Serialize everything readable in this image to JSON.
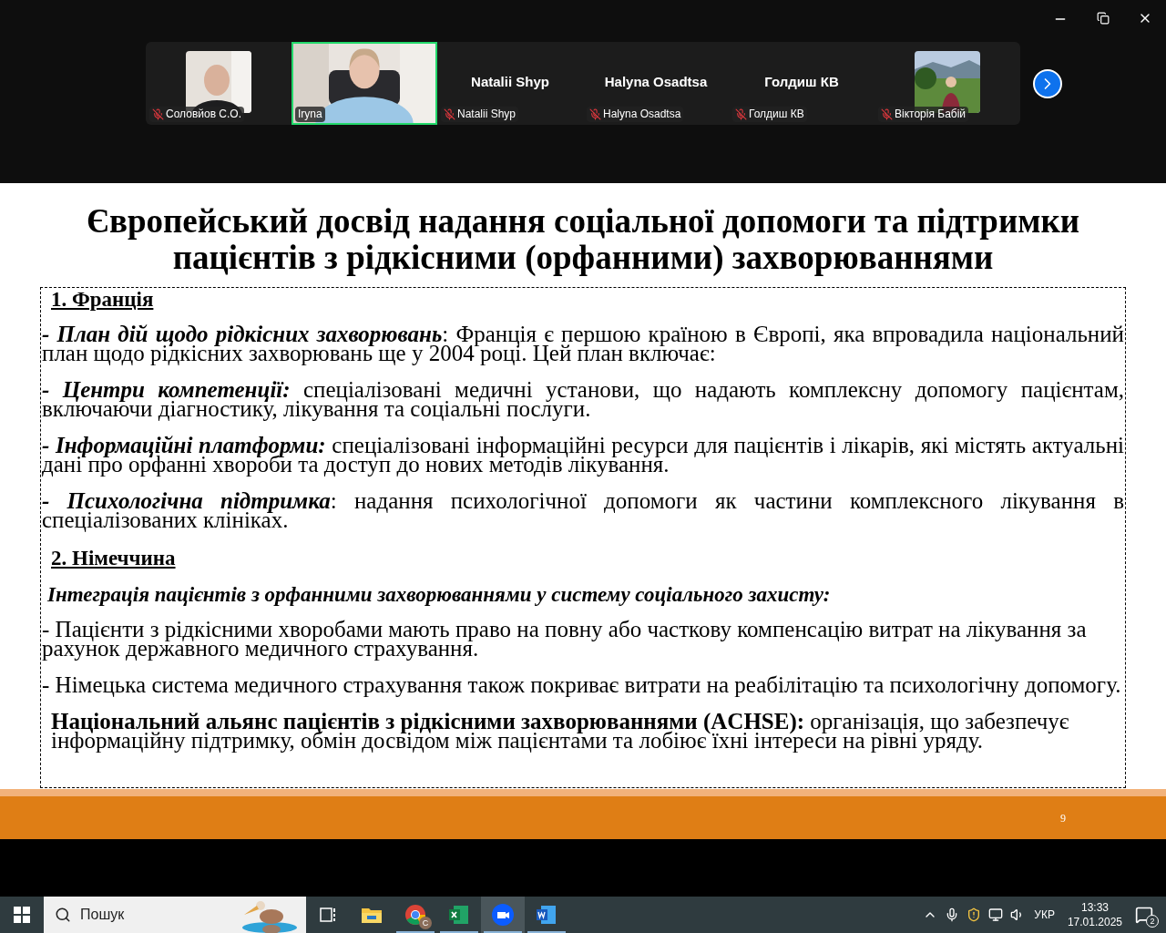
{
  "participants": [
    {
      "kind": "video",
      "name": "Соловйов С.О.",
      "muted": true,
      "selected": false
    },
    {
      "kind": "video_full",
      "name": "Iryna",
      "muted": false,
      "selected": true
    },
    {
      "kind": "name_only",
      "display_name": "Natalii Shyp",
      "name": "Natalii Shyp",
      "muted": true,
      "selected": false
    },
    {
      "kind": "name_only",
      "display_name": "Halyna Osadtsa",
      "name": "Halyna Osadtsa",
      "muted": true,
      "selected": false
    },
    {
      "kind": "name_only",
      "display_name": "Голдиш КВ",
      "name": "Голдиш КВ",
      "muted": true,
      "selected": false
    },
    {
      "kind": "video",
      "name": "Вікторія Бабій",
      "muted": true,
      "selected": false
    }
  ],
  "slide": {
    "title": "Європейський досвід надання соціальної допомоги та підтримки пацієнтів з рідкісними (орфанними) захворюваннями",
    "paragraphs": [
      {
        "kind": "heading",
        "text": "1. Франція"
      },
      {
        "kind": "item",
        "lead": "- План дій щодо рідкісних захворювань",
        "text": ": Франція є першою країною в Європі, яка впровадила національний план щодо рідкісних захворювань ще у 2004 році. Цей план включає:"
      },
      {
        "kind": "item",
        "lead": "- Центри компетенції:",
        "text": " спеціалізовані медичні установи, що надають комплексну допомогу пацієнтам, включаючи діагностику, лікування та соціальні послуги."
      },
      {
        "kind": "item",
        "lead": "- Інформаційні платформи:",
        "text": " спеціалізовані інформаційні ресурси для пацієнтів і лікарів, які містять актуальні дані про орфанні хвороби та доступ до нових методів лікування."
      },
      {
        "kind": "item",
        "lead": "- Психологічна підтримка",
        "text": ": надання психологічної допомоги як частини комплексного лікування в спеціалізованих клініках."
      },
      {
        "kind": "heading",
        "text": "2. Німеччина"
      },
      {
        "kind": "subheading",
        "text": "Інтеграція пацієнтів з орфанними захворюваннями у систему соціального захисту:"
      },
      {
        "kind": "plain",
        "text": "- Пацієнти з рідкісними хворобами мають право на повну або часткову компенсацію витрат на лікування за рахунок державного медичного страхування."
      },
      {
        "kind": "plain",
        "text": "- Німецька система медичного страхування також покриває витрати на реабілітацію та психологічну допомогу."
      },
      {
        "kind": "item_bold",
        "lead": "Національний альянс пацієнтів з рідкісними захворюваннями (ACHSE):",
        "text": " організація, що забезпечує інформаційну підтримку, обмін досвідом між пацієнтами та лобіює їхні інтереси на рівні уряду."
      }
    ],
    "page_number": "9"
  },
  "taskbar": {
    "search": {
      "placeholder": "Пошук"
    },
    "apps": [
      {
        "kind": "task_view",
        "running": false,
        "selected": false
      },
      {
        "kind": "explorer",
        "running": false,
        "selected": false
      },
      {
        "kind": "chrome",
        "running": true,
        "selected": false,
        "badge": "C"
      },
      {
        "kind": "excel",
        "running": true,
        "selected": false
      },
      {
        "kind": "zoom",
        "running": true,
        "selected": true
      },
      {
        "kind": "word",
        "running": true,
        "selected": false
      }
    ],
    "language": "УКР",
    "time": "13:33",
    "date": "17.01.2025",
    "notifications": "2"
  }
}
